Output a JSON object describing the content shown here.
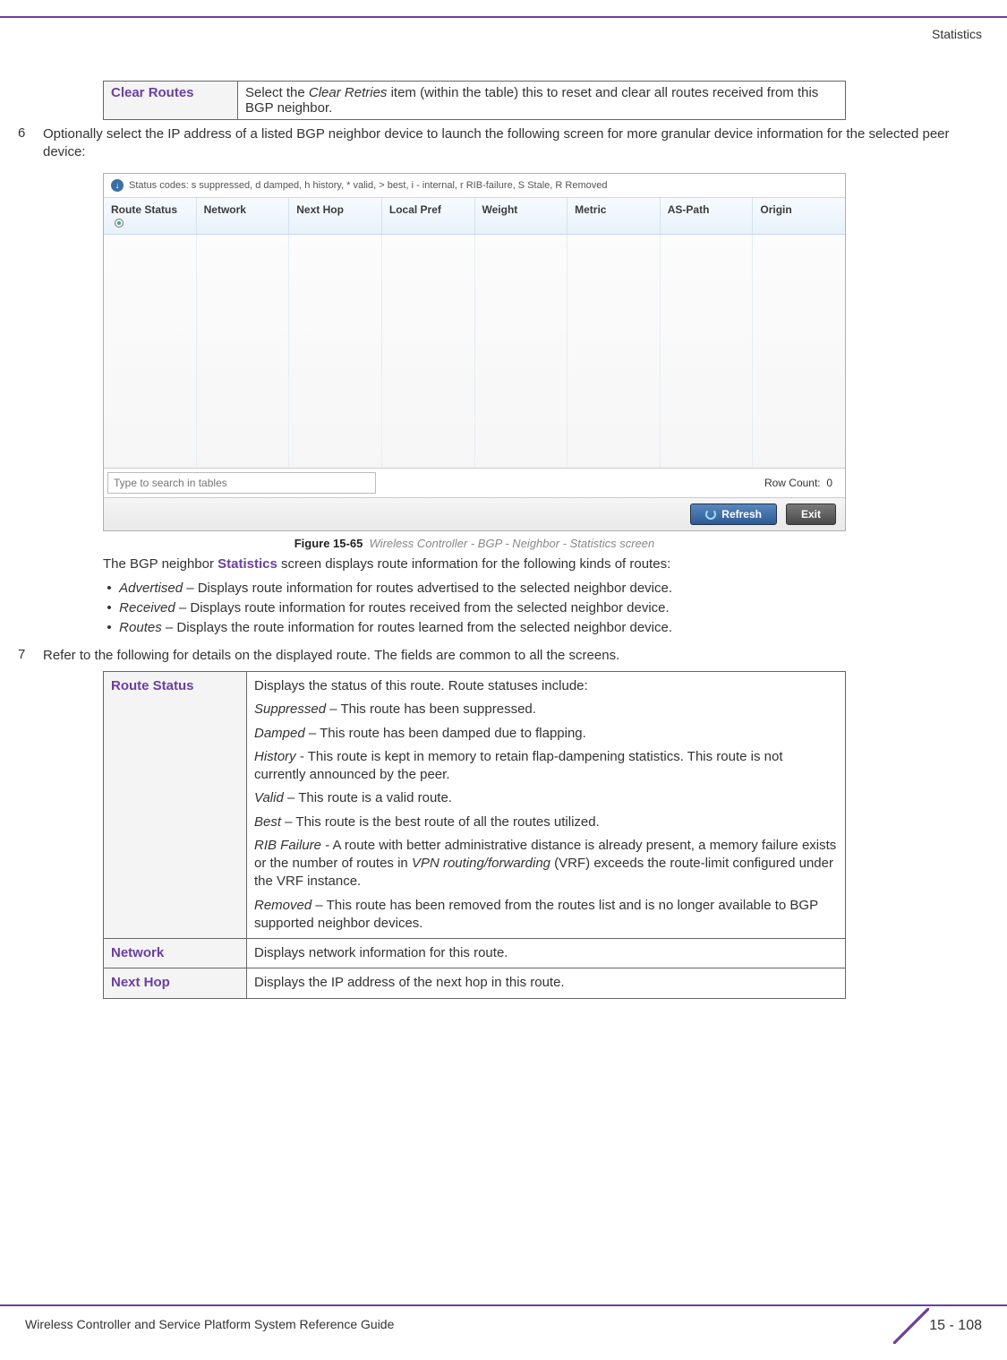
{
  "header": {
    "section": "Statistics"
  },
  "table1": {
    "label": "Clear Routes",
    "desc_pre": "Select the ",
    "desc_em": "Clear Retries",
    "desc_post": " item (within the table) this to reset and clear all routes received from this BGP neighbor."
  },
  "step6": {
    "num": "6",
    "text": "Optionally select the IP address of a listed BGP neighbor device to launch the following screen for more granular device information for the selected peer device:"
  },
  "screenshot": {
    "status_codes": "Status codes: s suppressed, d damped, h history, * valid, > best, i - internal, r RIB-failure, S Stale, R Removed",
    "columns": [
      "Route Status",
      "Network",
      "Next Hop",
      "Local Pref",
      "Weight",
      "Metric",
      "AS-Path",
      "Origin"
    ],
    "search_placeholder": "Type to search in tables",
    "row_count_label": "Row Count:",
    "row_count_value": "0",
    "refresh": "Refresh",
    "exit": "Exit"
  },
  "figure": {
    "label": "Figure 15-65",
    "caption": "Wireless Controller - BGP - Neighbor - Statistics screen"
  },
  "intro": {
    "pre": "The BGP neighbor ",
    "word": "Statistics",
    "post": " screen displays route information for the following kinds of routes:"
  },
  "bullets": [
    {
      "em": "Advertised",
      "text": " – Displays route information for routes advertised to the selected neighbor device."
    },
    {
      "em": "Received",
      "text": " – Displays route information for routes received from the selected neighbor device."
    },
    {
      "em": "Routes",
      "text": " – Displays the route information for routes learned from the selected neighbor device."
    }
  ],
  "step7": {
    "num": "7",
    "text": "Refer to the following for details on the displayed route. The fields are common to all the screens."
  },
  "def": {
    "route_status": {
      "label": "Route Status",
      "intro": "Displays the status of this route. Route statuses include:",
      "items": [
        {
          "em": "Suppressed",
          "txt": " – This route has been suppressed."
        },
        {
          "em": "Damped",
          "txt": " – This route has been damped due to flapping."
        },
        {
          "em": "History",
          "txt": " - This route is kept in memory to retain flap-dampening statistics. This route is not currently announced by the peer."
        },
        {
          "em": "Valid",
          "txt": " – This route is a valid route."
        },
        {
          "em": "Best",
          "txt": " – This route is the best route of all the routes utilized."
        }
      ],
      "rib_pre": "RIB Failure",
      "rib_mid1": " - A route with better administrative distance is already present, a memory failure exists or the number of routes in ",
      "rib_em2": "VPN routing/forwarding",
      "rib_mid2": " (VRF) exceeds the route-limit configured under the VRF instance.",
      "removed_em": "Removed",
      "removed_txt": " – This route has been removed from the routes list and is no longer available to BGP supported neighbor devices."
    },
    "network": {
      "label": "Network",
      "txt": "Displays network information for this route."
    },
    "nexthop": {
      "label": "Next Hop",
      "txt": "Displays the IP address of the next hop in this route."
    }
  },
  "footer": {
    "text": "Wireless Controller and Service Platform System Reference Guide",
    "page": "15 - 108"
  }
}
